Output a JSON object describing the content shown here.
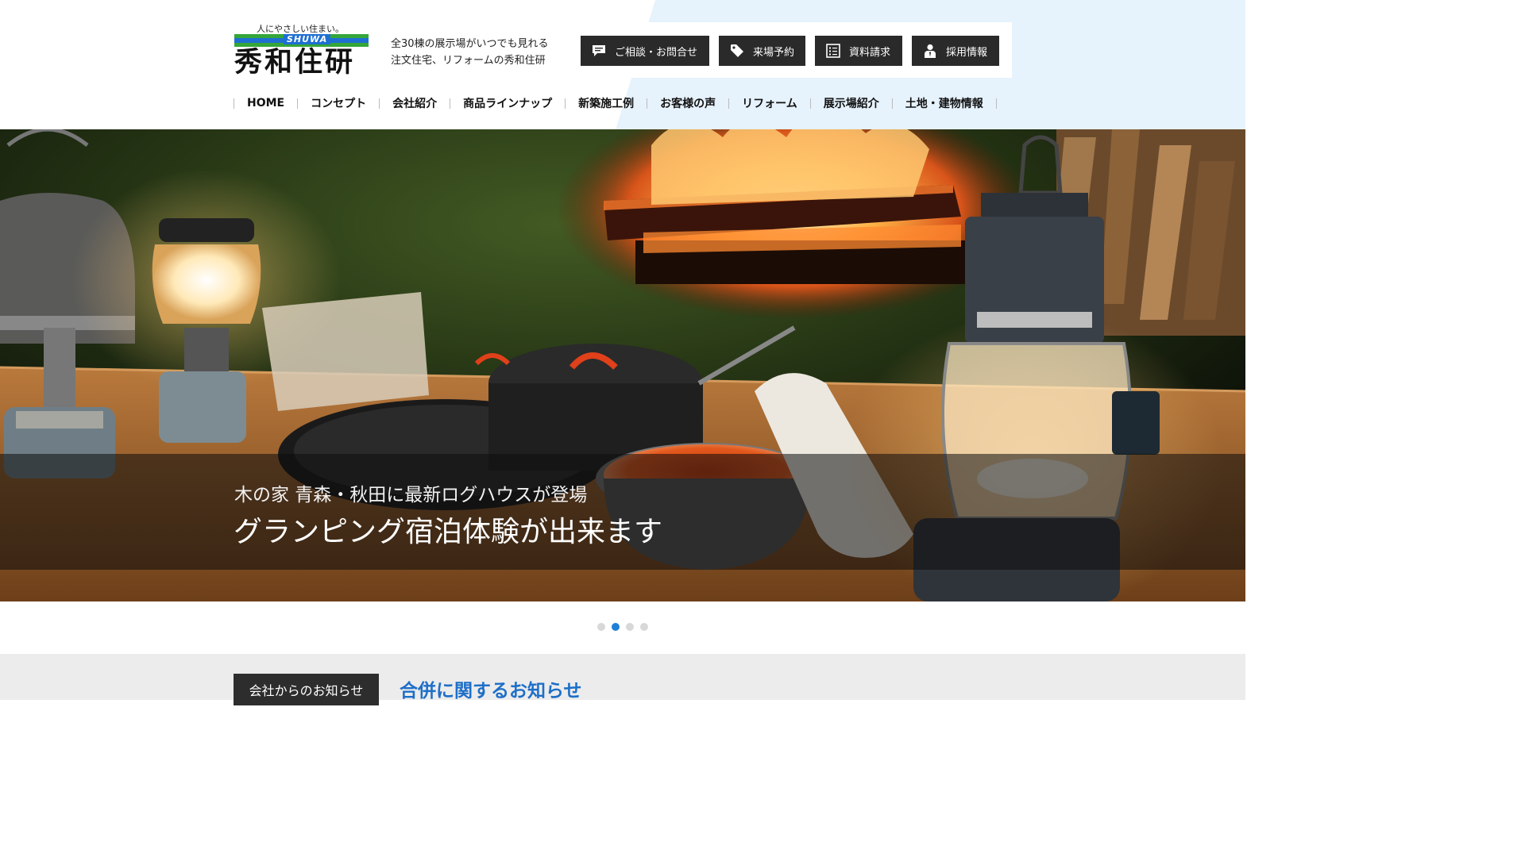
{
  "header": {
    "logo": {
      "tagline": "人にやさしい住まい。",
      "stripe_word": "SHUWA",
      "brand": "秀和住研"
    },
    "catch_line1": "全30棟の展示場がいつでも見れる",
    "catch_line2": "注文住宅、リフォームの秀和住研",
    "buttons": [
      {
        "label": "ご相談・お問合せ",
        "icon": "speech-bubble-icon"
      },
      {
        "label": "来場予約",
        "icon": "tag-icon"
      },
      {
        "label": "資料請求",
        "icon": "document-list-icon"
      },
      {
        "label": "採用情報",
        "icon": "person-icon"
      }
    ]
  },
  "nav": [
    "HOME",
    "コンセプト",
    "会社紹介",
    "商品ラインナップ",
    "新築施工例",
    "お客様の声",
    "リフォーム",
    "展示場紹介",
    "土地・建物情報"
  ],
  "hero": {
    "caption_line1": "木の家 青森・秋田に最新ログハウスが登場",
    "caption_line2": "グランピング宿泊体験が出来ます",
    "slide_count": 4,
    "active_slide": 2
  },
  "news": {
    "label": "会社からのお知らせ",
    "title": "合併に関するお知らせ"
  },
  "colors": {
    "accent": "#1e6fc8",
    "dark_button": "#2a2a2a",
    "logo_green": "#35a639",
    "logo_blue": "#1e6fd2"
  }
}
